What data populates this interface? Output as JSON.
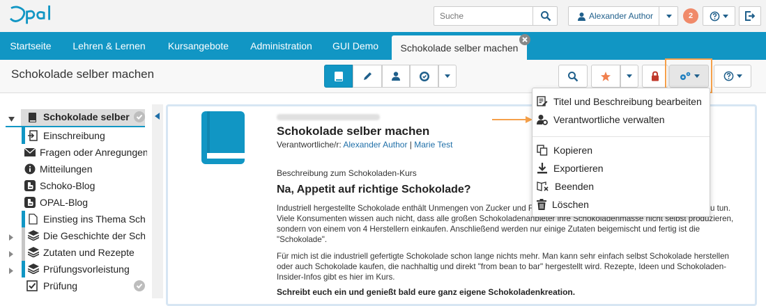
{
  "header": {
    "logo_text": "Opal",
    "search": {
      "placeholder": "Suche"
    },
    "user_name": "Alexander Author",
    "notification_count": "2"
  },
  "nav": {
    "tabs": [
      {
        "label": "Startseite"
      },
      {
        "label": "Lehren & Lernen"
      },
      {
        "label": "Kursangebote"
      },
      {
        "label": "Administration"
      },
      {
        "label": "GUI Demo"
      },
      {
        "label": "Schokolade selber machen",
        "active": true
      }
    ]
  },
  "course": {
    "title": "Schokolade selber machen"
  },
  "sidebar": {
    "root_label": "Schokolade selber machen",
    "items": [
      {
        "label": "Einschreibung",
        "icon": "enrollment-icon"
      },
      {
        "label": "Fragen oder Anregungen",
        "icon": "envelope-icon"
      },
      {
        "label": "Mitteilungen",
        "icon": "info-icon"
      },
      {
        "label": "Schoko-Blog",
        "icon": "blog-icon"
      },
      {
        "label": "OPAL-Blog",
        "icon": "blog-icon"
      },
      {
        "label": "Einstieg ins Thema Schokolade",
        "icon": "page-icon"
      },
      {
        "label": "Die Geschichte der Schokolade",
        "icon": "layers-icon"
      },
      {
        "label": "Zutaten und Rezepte",
        "icon": "layers-icon"
      },
      {
        "label": "Prüfungsvorleistung",
        "icon": "layers-icon"
      },
      {
        "label": "Prüfung",
        "icon": "checkbox-icon"
      }
    ]
  },
  "content": {
    "title": "Schokolade selber machen",
    "responsible_label": "Verantwortliche/r:",
    "responsible": [
      "Alexander Author",
      "Marie Test"
    ],
    "separator": "|",
    "description_label": "Beschreibung zum Schokoladen-Kurs",
    "heading": "Na, Appetit auf richtige Schokolade?",
    "paragraph1": "Industriell hergestellte Schokolade enthält Unmengen von Zucker und Fett, nur wenig von der eigentlichen Kakaobohne zu tun. Viele Konsumenten wissen auch nicht, dass alle großen Schokoladenanbieter ihre Schokoladenmasse nicht selbst produzieren, sondern von einem von 4 Herstellern einkaufen. Anschließend werden nur einige Zutaten beigemischt und fertig ist die \"Schokolade\".",
    "paragraph2": "Für mich ist die industriell gefertigte Schokolade schon lange nichts mehr. Man kann sehr einfach selbst Schokolade herstellen oder auch Schokolade kaufen, die nachhaltig und direkt \"from bean to bar\" hergestellt wird. Rezepte, Ideen und Schokoladen-Insider-Infos gibt es hier im Kurs.",
    "paragraph3": "Schreibt euch ein und genießt bald eure ganz eigene Schokoladenkreation."
  },
  "dropdown": {
    "items": [
      {
        "label": "Titel und Beschreibung bearbeiten",
        "icon": "edit-doc-icon"
      },
      {
        "label": "Verantwortliche verwalten",
        "icon": "user-gear-icon"
      },
      {
        "label": "Kopieren",
        "icon": "copy-icon"
      },
      {
        "label": "Exportieren",
        "icon": "download-icon"
      },
      {
        "label": "Beenden",
        "icon": "end-icon"
      },
      {
        "label": "Löschen",
        "icon": "trash-icon"
      }
    ]
  },
  "colors": {
    "brand": "#1196c4",
    "highlight": "#f5a04a",
    "badge": "#f08a6a",
    "link": "#1f6fa8"
  }
}
